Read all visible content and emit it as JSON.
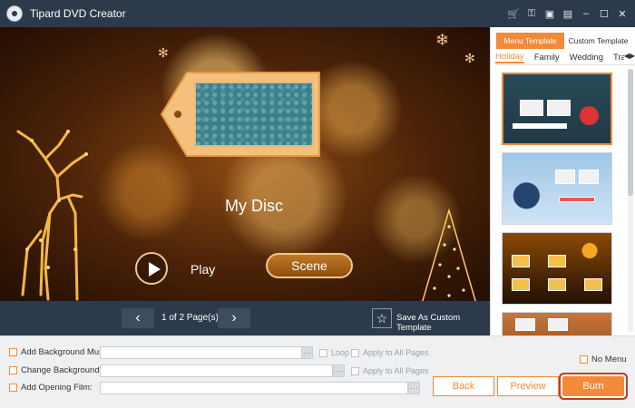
{
  "app": {
    "title": "Tipard DVD Creator"
  },
  "titlebar_icons": [
    "cart-icon",
    "key-icon",
    "save-icon",
    "feedback-icon",
    "minimize-icon",
    "maximize-icon",
    "close-icon"
  ],
  "preview": {
    "disc_title": "My Disc",
    "play_label": "Play",
    "scene_label": "Scene"
  },
  "pagebar": {
    "page_count": "1 of 2 Page(s)",
    "save_template": "Save As Custom Template"
  },
  "template_panel": {
    "tabs": [
      {
        "label": "Menu Template",
        "active": true
      },
      {
        "label": "Custom Template",
        "active": false
      }
    ],
    "categories": [
      "Holiday",
      "Family",
      "Wedding",
      "Tra"
    ],
    "active_category": "Holiday",
    "arrows": "◀▶"
  },
  "options": {
    "bg_music_label": "Add Background Music:",
    "change_bg_label": "Change Background:",
    "opening_film_label": "Add Opening Film:",
    "loop_label": "Loop",
    "apply_all_label": "Apply to All Pages",
    "apply_all_label_2": "Apply to All Pages",
    "no_menu_label": "No Menu",
    "browse": "···"
  },
  "buttons": {
    "back": "Back",
    "preview": "Preview",
    "burn": "Burn"
  },
  "colors": {
    "accent": "#f28a3a",
    "titlebar": "#2d3a4b",
    "highlight": "#c53a22"
  }
}
